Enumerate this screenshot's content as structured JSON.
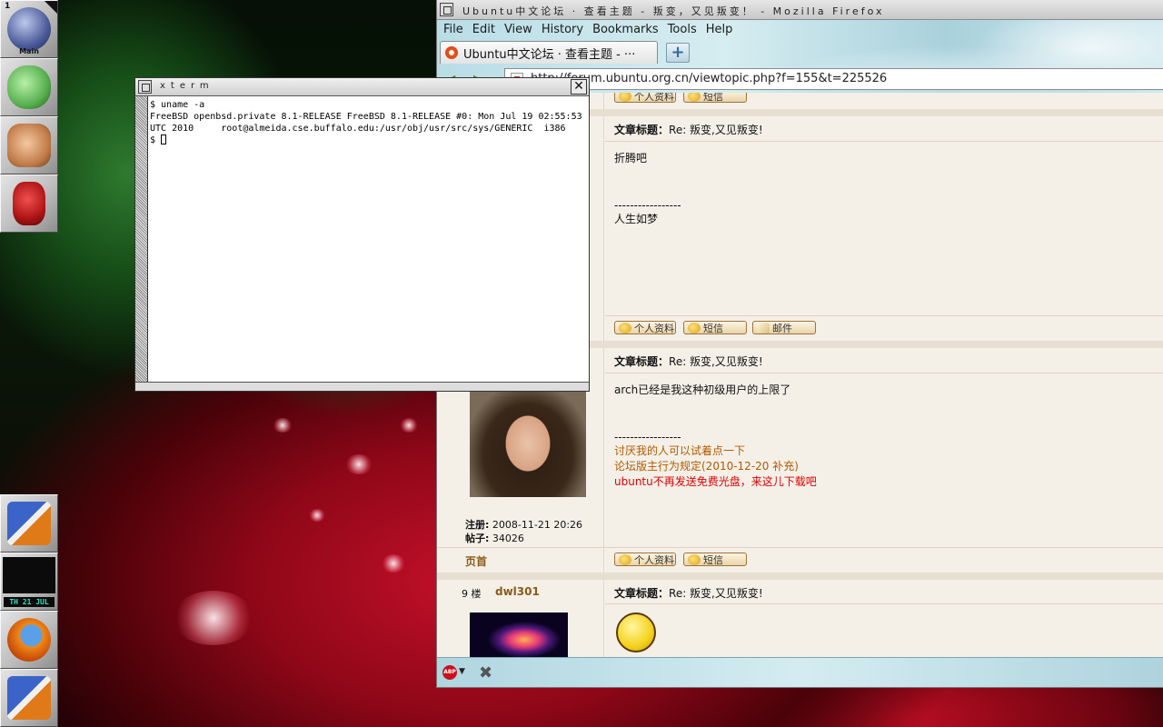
{
  "desktop": {
    "dock": {
      "workspace": {
        "number": "1",
        "name": "Main"
      },
      "clock_date": "TH 21 JUL"
    }
  },
  "firefox": {
    "title": "Ubuntu中文论坛 · 查看主题 - 叛变，又见叛变！ - Mozilla Firefox",
    "menu": [
      "File",
      "Edit",
      "View",
      "History",
      "Bookmarks",
      "Tools",
      "Help"
    ],
    "tab_label": "Ubuntu中文论坛 · 查看主题 - ···",
    "url": "http://forum.ubuntu.org.cn/viewtopic.php?f=155&t=225526",
    "buttons": {
      "profile": "个人资料",
      "pm": "短信",
      "email": "邮件"
    },
    "posts": [
      {
        "title_label": "文章标题：",
        "title": "Re: 叛变,又见叛变!",
        "body": "折腾吧",
        "sig_divider": "-----------------",
        "signature": [
          "人生如梦"
        ]
      },
      {
        "title_label": "文章标题：",
        "title": "Re: 叛变,又见叛变!",
        "body": "arch已经是我这种初级用户的上限了",
        "sig_divider": "-----------------",
        "signature": [
          "讨厌我的人可以试着点一下",
          "论坛版主行为规定(2010-12-20 补充)",
          "ubuntu不再发送免费光盘，来这儿下载吧"
        ],
        "signature_colors": [
          "#b35a00",
          "#b35a00",
          "#e00000"
        ],
        "meta": {
          "register_label": "注册:",
          "register_value": "2008-11-21 20:26",
          "posts_label": "帖子:",
          "posts_value": "34026"
        },
        "top_link": "页首"
      },
      {
        "floor_label": "9 楼",
        "username": "dwl301",
        "title_label": "文章标题：",
        "title": "Re: 叛变,又见叛变!"
      }
    ],
    "statusbar": {
      "abp": "ABP"
    }
  },
  "xterm": {
    "title": "xterm",
    "lines": [
      "$ uname -a",
      "FreeBSD openbsd.private 8.1-RELEASE FreeBSD 8.1-RELEASE #0: Mon Jul 19 02:55:53",
      "UTC 2010     root@almeida.cse.buffalo.edu:/usr/obj/usr/src/sys/GENERIC  i386"
    ],
    "prompt": "$ "
  }
}
